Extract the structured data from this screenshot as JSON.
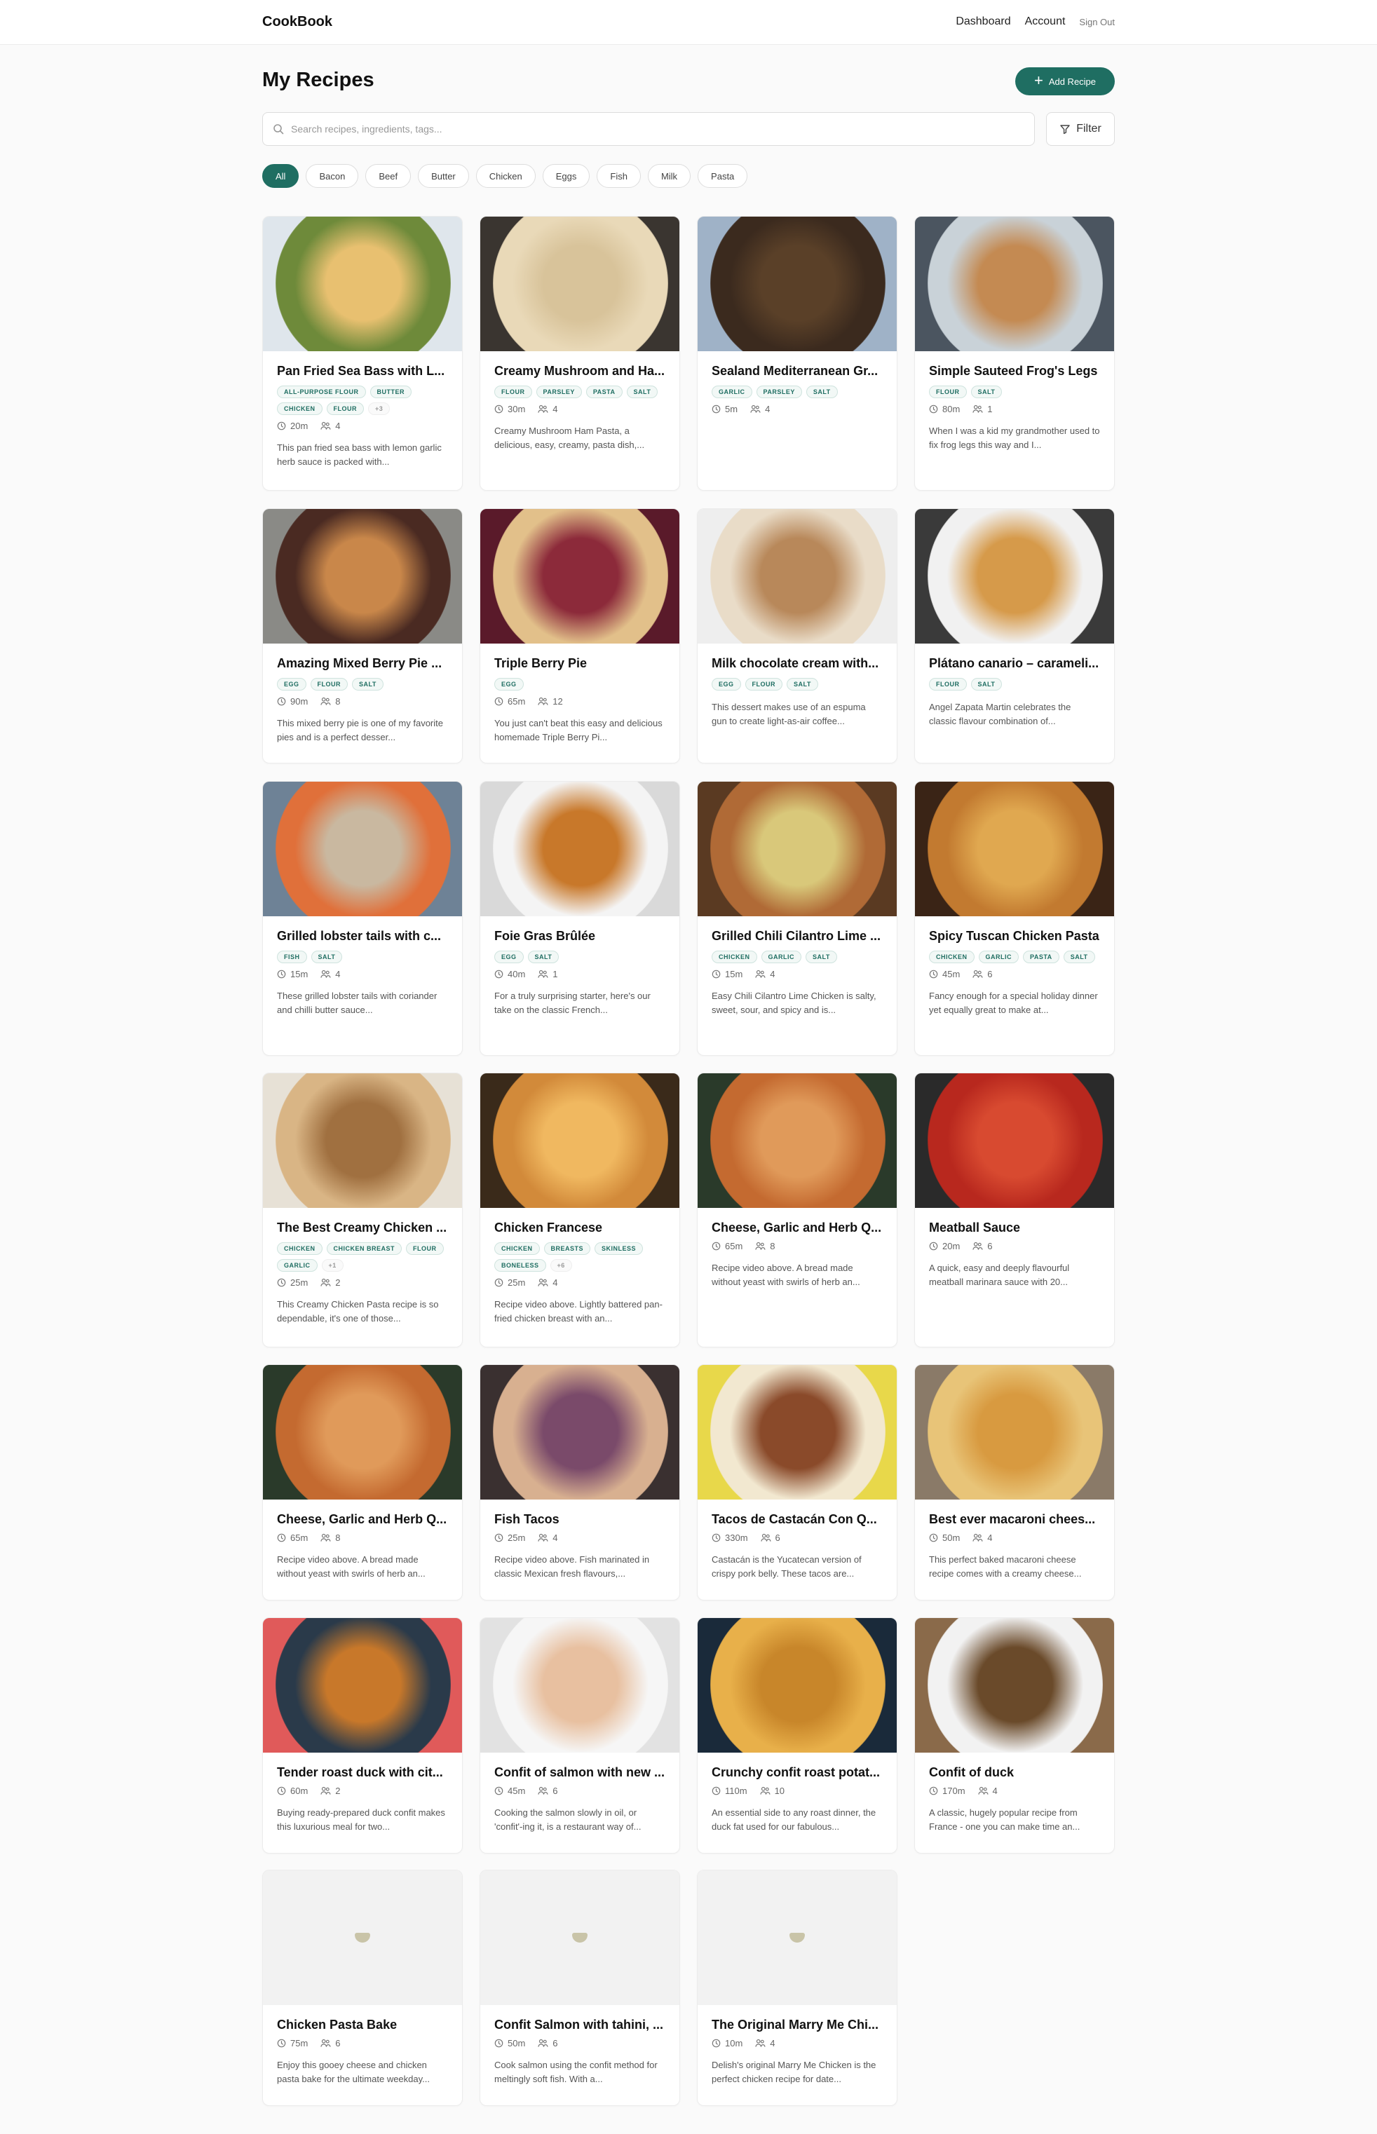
{
  "brand": "CookBook",
  "nav": {
    "dashboard": "Dashboard",
    "account": "Account",
    "signout": "Sign Out"
  },
  "page_title": "My Recipes",
  "add_button": "Add Recipe",
  "search": {
    "placeholder": "Search recipes, ingredients, tags..."
  },
  "filter_button": "Filter",
  "chips": [
    "All",
    "Bacon",
    "Beef",
    "Butter",
    "Chicken",
    "Eggs",
    "Fish",
    "Milk",
    "Pasta"
  ],
  "recipes": [
    {
      "title": "Pan Fried Sea Bass with L...",
      "tags": [
        "ALL-PURPOSE FLOUR",
        "BUTTER",
        "CHICKEN",
        "FLOUR",
        "+3"
      ],
      "time": "20m",
      "servings": "4",
      "desc": "This pan fried sea bass with lemon garlic herb sauce is packed with...",
      "colors": [
        "#dfe6ec",
        "#6e8a3a",
        "#e8c070"
      ]
    },
    {
      "title": "Creamy Mushroom and Ha...",
      "tags": [
        "FLOUR",
        "PARSLEY",
        "PASTA",
        "SALT"
      ],
      "time": "30m",
      "servings": "4",
      "desc": "Creamy Mushroom Ham Pasta, a delicious, easy, creamy, pasta dish,...",
      "colors": [
        "#3a3530",
        "#e9d9b8",
        "#d8c39a"
      ]
    },
    {
      "title": "Sealand Mediterranean Gr...",
      "tags": [
        "GARLIC",
        "PARSLEY",
        "SALT"
      ],
      "time": "5m",
      "servings": "4",
      "desc": "",
      "colors": [
        "#9fb2c7",
        "#3b2a1e",
        "#5a4028"
      ]
    },
    {
      "title": "Simple Sauteed Frog's Legs",
      "tags": [
        "FLOUR",
        "SALT"
      ],
      "time": "80m",
      "servings": "1",
      "desc": "When I was a kid my grandmother used to fix frog legs this way and I...",
      "colors": [
        "#4b5560",
        "#c9d2d8",
        "#c48a52"
      ]
    },
    {
      "title": "Amazing Mixed Berry Pie ...",
      "tags": [
        "EGG",
        "FLOUR",
        "SALT"
      ],
      "time": "90m",
      "servings": "8",
      "desc": "This mixed berry pie is one of my favorite pies and is a perfect desser...",
      "colors": [
        "#8a8a86",
        "#4a2a22",
        "#c9874a"
      ]
    },
    {
      "title": "Triple Berry Pie",
      "tags": [
        "EGG"
      ],
      "time": "65m",
      "servings": "12",
      "desc": "You just can't beat this easy and delicious homemade Triple Berry Pi...",
      "colors": [
        "#5a1a2a",
        "#e2c08a",
        "#8c2a3a"
      ]
    },
    {
      "title": "Milk chocolate cream with...",
      "tags": [
        "EGG",
        "FLOUR",
        "SALT"
      ],
      "time": "",
      "servings": "",
      "desc": "This dessert makes use of an espuma gun to create light-as-air coffee...",
      "colors": [
        "#eeeeee",
        "#e9dcc8",
        "#b8885a"
      ]
    },
    {
      "title": "Plátano canario – carameli...",
      "tags": [
        "FLOUR",
        "SALT"
      ],
      "time": "",
      "servings": "",
      "desc": "Angel Zapata Martin celebrates the classic flavour combination of...",
      "colors": [
        "#3a3a3a",
        "#f1f1f1",
        "#d69a4a"
      ]
    },
    {
      "title": "Grilled lobster tails with c...",
      "tags": [
        "FISH",
        "SALT"
      ],
      "time": "15m",
      "servings": "4",
      "desc": "These grilled lobster tails with coriander and chilli butter sauce...",
      "colors": [
        "#6e8296",
        "#e0703a",
        "#c9b8a0"
      ]
    },
    {
      "title": "Foie Gras Brûlée",
      "tags": [
        "EGG",
        "SALT"
      ],
      "time": "40m",
      "servings": "1",
      "desc": "For a truly surprising starter, here's our take on the classic French...",
      "colors": [
        "#d9d9d9",
        "#f4f4f4",
        "#c8782a"
      ]
    },
    {
      "title": "Grilled Chili Cilantro Lime ...",
      "tags": [
        "CHICKEN",
        "GARLIC",
        "SALT"
      ],
      "time": "15m",
      "servings": "4",
      "desc": "Easy Chili Cilantro Lime Chicken is salty, sweet, sour, and spicy and is...",
      "colors": [
        "#5a3a22",
        "#b06a36",
        "#d9c87a"
      ]
    },
    {
      "title": "Spicy Tuscan Chicken Pasta",
      "tags": [
        "CHICKEN",
        "GARLIC",
        "PASTA",
        "SALT"
      ],
      "time": "45m",
      "servings": "6",
      "desc": "Fancy enough for a special holiday dinner yet equally great to make at...",
      "colors": [
        "#3a2416",
        "#c27a30",
        "#e0a850"
      ]
    },
    {
      "title": "The Best Creamy Chicken ...",
      "tags": [
        "CHICKEN",
        "CHICKEN BREAST",
        "FLOUR",
        "GARLIC",
        "+1"
      ],
      "time": "25m",
      "servings": "2",
      "desc": "This Creamy Chicken Pasta recipe is so dependable, it's one of those...",
      "colors": [
        "#e7e1d6",
        "#d9b585",
        "#a07040"
      ]
    },
    {
      "title": "Chicken Francese",
      "tags": [
        "CHICKEN",
        "BREASTS",
        "SKINLESS",
        "BONELESS",
        "+6"
      ],
      "time": "25m",
      "servings": "4",
      "desc": "Recipe video above. Lightly battered pan-fried chicken breast with an...",
      "colors": [
        "#3a2a1a",
        "#d28a3a",
        "#f0b860"
      ]
    },
    {
      "title": "Cheese, Garlic and Herb Q...",
      "tags": [],
      "time": "65m",
      "servings": "8",
      "desc": "Recipe video above. A bread made without yeast with swirls of herb an...",
      "colors": [
        "#2a3a2a",
        "#c46a30",
        "#e09a5a"
      ]
    },
    {
      "title": "Meatball Sauce",
      "tags": [],
      "time": "20m",
      "servings": "6",
      "desc": "A quick, easy and deeply flavourful meatball marinara sauce with 20...",
      "colors": [
        "#2a2a2a",
        "#b8281e",
        "#d84a30"
      ]
    },
    {
      "title": "Cheese, Garlic and Herb Q...",
      "tags": [],
      "time": "65m",
      "servings": "8",
      "desc": "Recipe video above. A bread made without yeast with swirls of herb an...",
      "colors": [
        "#2a3a2a",
        "#c46a30",
        "#e09a5a"
      ]
    },
    {
      "title": "Fish Tacos",
      "tags": [],
      "time": "25m",
      "servings": "4",
      "desc": "Recipe video above. Fish marinated in classic Mexican fresh flavours,...",
      "colors": [
        "#3a3030",
        "#d8b090",
        "#7a4a6a"
      ]
    },
    {
      "title": "Tacos de Castacán Con Q...",
      "tags": [],
      "time": "330m",
      "servings": "6",
      "desc": "Castacán is the Yucatecan version of crispy pork belly. These tacos are...",
      "colors": [
        "#e8d84a",
        "#f2e8d0",
        "#8a4a2a"
      ]
    },
    {
      "title": "Best ever macaroni chees...",
      "tags": [],
      "time": "50m",
      "servings": "4",
      "desc": "This perfect baked macaroni cheese recipe comes with a creamy cheese...",
      "colors": [
        "#8a7a68",
        "#e8c478",
        "#d89a40"
      ]
    },
    {
      "title": "Tender roast duck with cit...",
      "tags": [],
      "time": "60m",
      "servings": "2",
      "desc": "Buying ready-prepared duck confit makes this luxurious meal for two...",
      "colors": [
        "#e05a5a",
        "#2a3a4a",
        "#c8782a"
      ]
    },
    {
      "title": "Confit of salmon with new ...",
      "tags": [],
      "time": "45m",
      "servings": "6",
      "desc": "Cooking the salmon slowly in oil, or 'confit'-ing it, is a restaurant way of...",
      "colors": [
        "#e2e2e2",
        "#f6f6f6",
        "#e8c0a0"
      ]
    },
    {
      "title": "Crunchy confit roast potat...",
      "tags": [],
      "time": "110m",
      "servings": "10",
      "desc": "An essential side to any roast dinner, the duck fat used for our fabulous...",
      "colors": [
        "#1a2a3a",
        "#e8b04a",
        "#c8862a"
      ]
    },
    {
      "title": "Confit of duck",
      "tags": [],
      "time": "170m",
      "servings": "4",
      "desc": "A classic, hugely popular recipe from France - one you can make time an...",
      "colors": [
        "#8a6a4a",
        "#f2f2f2",
        "#6a4a2a"
      ]
    },
    {
      "title": "Chicken Pasta Bake",
      "tags": [],
      "time": "75m",
      "servings": "6",
      "desc": "Enjoy this gooey cheese and chicken pasta bake for the ultimate weekday...",
      "colors": [
        "#f2f2f2",
        "#f2f2f2",
        "#f2f2f2"
      ],
      "placeholder": true
    },
    {
      "title": "Confit Salmon with tahini, ...",
      "tags": [],
      "time": "50m",
      "servings": "6",
      "desc": "Cook salmon using the confit method for meltingly soft fish. With a...",
      "colors": [
        "#f2f2f2",
        "#f2f2f2",
        "#f2f2f2"
      ],
      "placeholder": true
    },
    {
      "title": "The Original Marry Me Chi...",
      "tags": [],
      "time": "10m",
      "servings": "4",
      "desc": "Delish's original Marry Me Chicken is the perfect chicken recipe for date...",
      "colors": [
        "#f2f2f2",
        "#f2f2f2",
        "#f2f2f2"
      ],
      "placeholder": true
    }
  ],
  "colors": {
    "accent": "#1f6e62"
  }
}
